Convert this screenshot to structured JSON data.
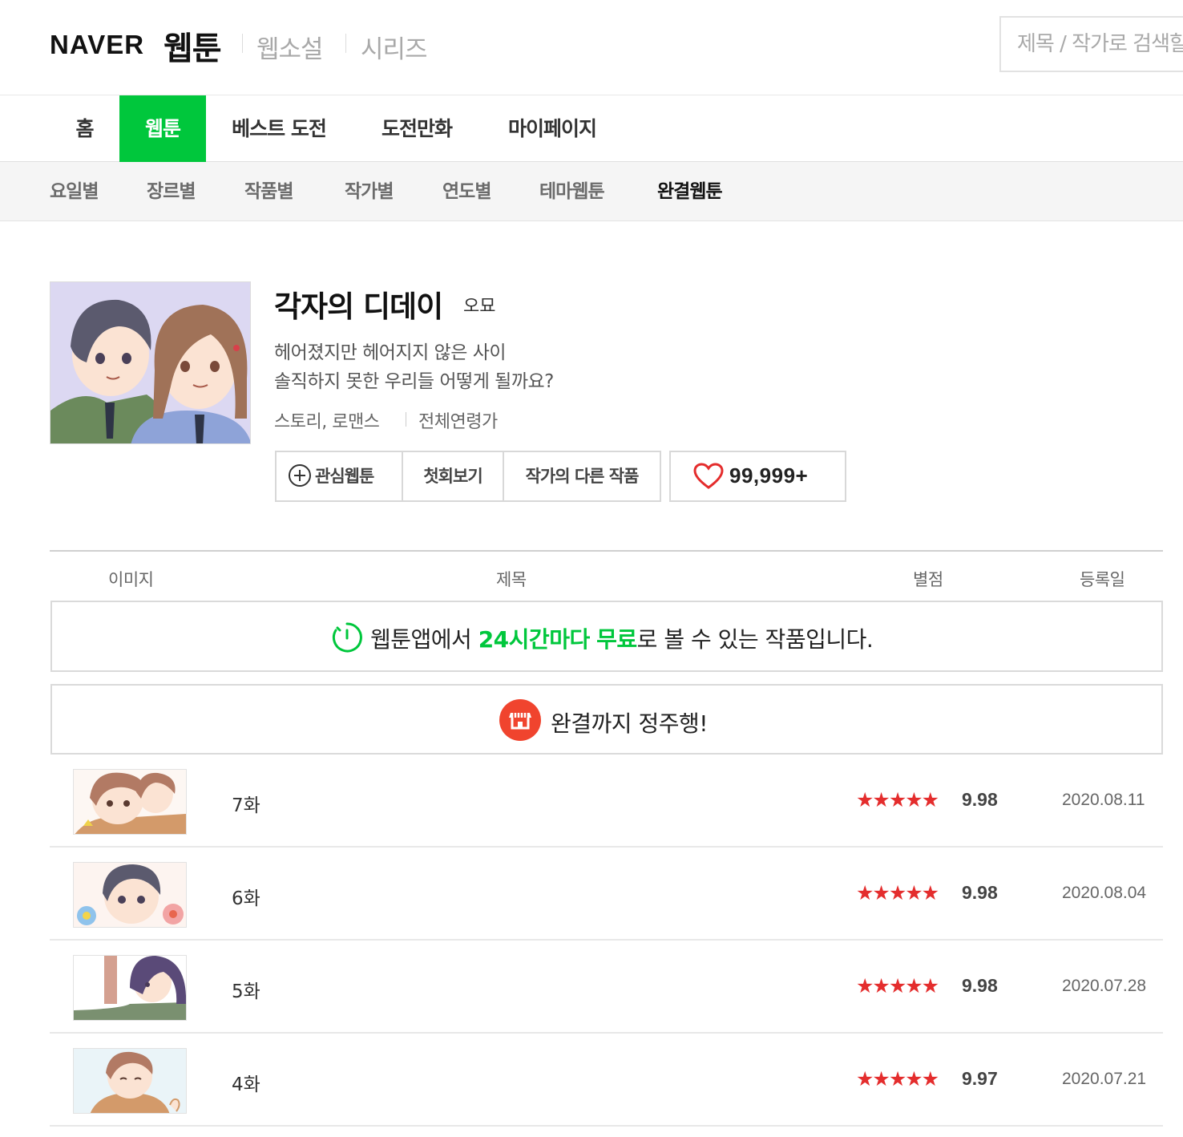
{
  "header": {
    "logo": "NAVER",
    "service_main": "웹툰",
    "service_links": [
      "웹소설",
      "시리즈"
    ],
    "search_placeholder": "제목 / 작가로 검색할 수 있습니다"
  },
  "main_nav": {
    "tabs": [
      {
        "label": "홈",
        "active": false
      },
      {
        "label": "웹툰",
        "active": true
      },
      {
        "label": "베스트 도전",
        "active": false
      },
      {
        "label": "도전만화",
        "active": false
      },
      {
        "label": "마이페이지",
        "active": false
      }
    ],
    "active_color": "#00c73c"
  },
  "sub_nav": {
    "tabs": [
      {
        "label": "요일별",
        "active": false
      },
      {
        "label": "장르별",
        "active": false
      },
      {
        "label": "작품별",
        "active": false
      },
      {
        "label": "작가별",
        "active": false
      },
      {
        "label": "연도별",
        "active": false
      },
      {
        "label": "테마웹툰",
        "active": false
      },
      {
        "label": "완결웹툰",
        "active": true
      }
    ]
  },
  "comic": {
    "title": "각자의 디데이",
    "author": "오묘",
    "description": [
      "헤어졌지만 헤어지지 않은 사이",
      "솔직하지 못한 우리들 어떻게 될까요?"
    ],
    "genre": "스토리, 로맨스",
    "age": "전체연령가",
    "buttons": {
      "favorite": "관심웹툰",
      "first_episode": "첫회보기",
      "author_other": "작가의 다른 작품"
    },
    "like_count": "99,999+",
    "icons": {
      "favorite": "plus-circle-icon",
      "like": "heart-icon",
      "thumbnail": "comic-cover-image"
    }
  },
  "list": {
    "columns": [
      "이미지",
      "제목",
      "별점",
      "등록일"
    ],
    "free_banner": {
      "prefix": "웹툰앱에서 ",
      "highlight1": "24시간마다",
      "middle": " ",
      "highlight2": "무료",
      "suffix": "로 볼 수 있는 작품입니다.",
      "icon": "timer-icon",
      "highlight_color": "#00c73c"
    },
    "ride_banner": {
      "text": "완결까지 정주행!",
      "icon": "shop-icon",
      "icon_color": "#f0442e"
    },
    "episodes": [
      {
        "title": "7화",
        "stars": "★★★★★",
        "rating": "9.98",
        "date": "2020.08.11"
      },
      {
        "title": "6화",
        "stars": "★★★★★",
        "rating": "9.98",
        "date": "2020.08.04"
      },
      {
        "title": "5화",
        "stars": "★★★★★",
        "rating": "9.98",
        "date": "2020.07.28"
      },
      {
        "title": "4화",
        "stars": "★★★★★",
        "rating": "9.97",
        "date": "2020.07.21"
      }
    ],
    "star_color": "#e42d2d"
  }
}
